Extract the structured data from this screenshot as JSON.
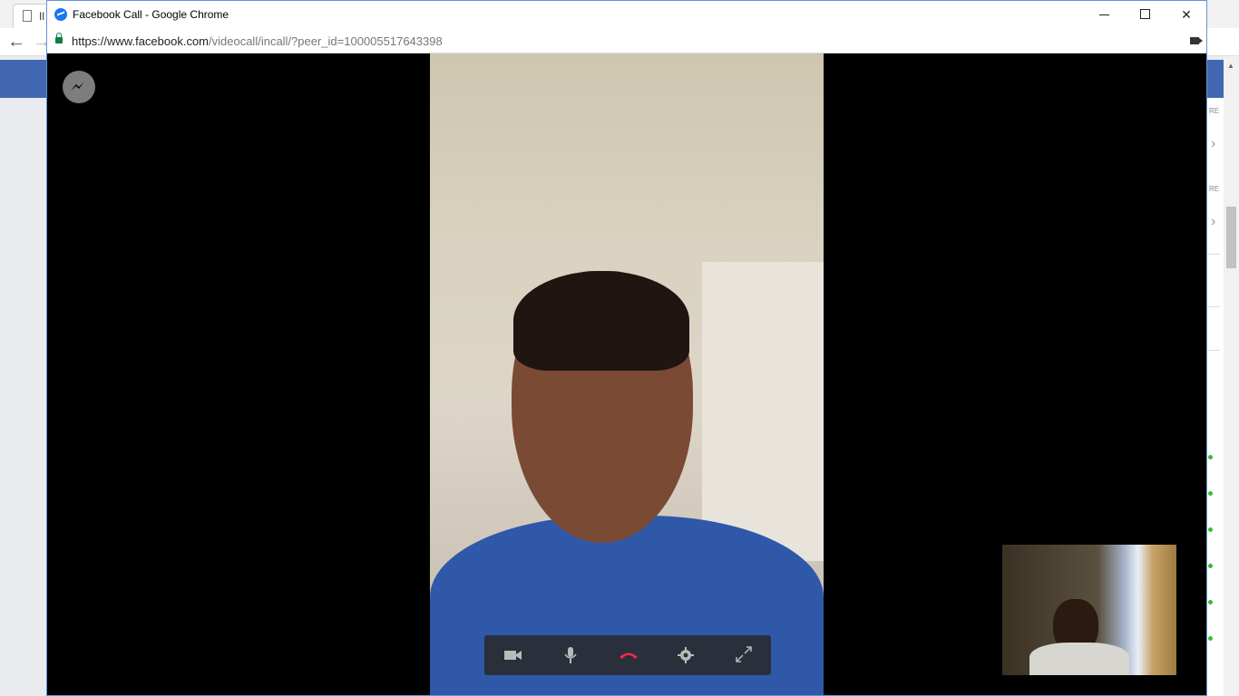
{
  "window": {
    "title": "Facebook Call - Google Chrome",
    "url_domain": "https://www.facebook.com",
    "url_path": "/videocall/incall/?peer_id=100005517643398"
  },
  "background_browser": {
    "tab_label": "Il",
    "right_labels": [
      "RE",
      "RE"
    ]
  },
  "call": {
    "controls": [
      "video-camera",
      "microphone",
      "end-call",
      "settings",
      "fullscreen"
    ],
    "end_call_color": "#f02849"
  },
  "colors": {
    "facebook_blue": "#4267b2",
    "window_border": "#5f95d6",
    "online_green": "#42b72a"
  }
}
